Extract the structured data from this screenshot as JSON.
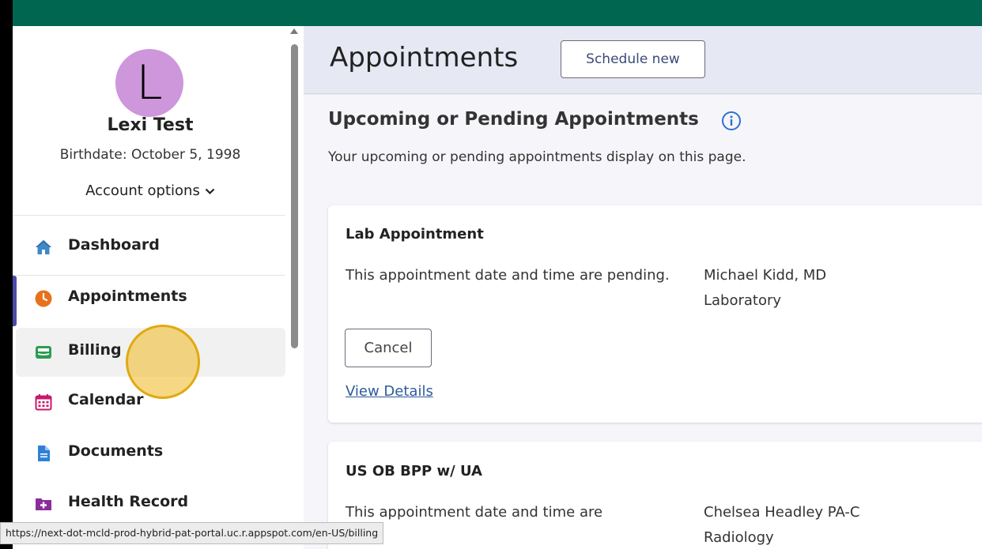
{
  "colors": {
    "topbar": "#00664f",
    "accent": "#4b4aa8",
    "link": "#2f5b9a",
    "avatar_bg": "#ce96db"
  },
  "user": {
    "initial": "L",
    "name": "Lexi Test",
    "birthdate": "Birthdate: October 5, 1998",
    "account_options": "Account options"
  },
  "sidebar": {
    "items": [
      {
        "label": "Dashboard",
        "icon": "home-icon"
      },
      {
        "label": "Appointments",
        "icon": "clock-icon"
      },
      {
        "label": "Billing",
        "icon": "billing-card-icon"
      },
      {
        "label": "Calendar",
        "icon": "calendar-icon"
      },
      {
        "label": "Documents",
        "icon": "document-icon"
      },
      {
        "label": "Health Record",
        "icon": "health-record-plus-icon"
      }
    ]
  },
  "header": {
    "title": "Appointments",
    "schedule_button": "Schedule new"
  },
  "section": {
    "title": "Upcoming or Pending Appointments",
    "description": "Your upcoming or pending appointments display on this page."
  },
  "appointments": [
    {
      "title": "Lab Appointment",
      "status": "This appointment date and time are pending.",
      "provider": "Michael Kidd, MD",
      "department": "Laboratory",
      "cancel_label": "Cancel",
      "details_label": "View Details"
    },
    {
      "title": "US OB BPP w/ UA",
      "status": "This appointment date and time are",
      "provider": "Chelsea Headley PA-C",
      "department": "Radiology"
    }
  ],
  "status_bar": {
    "url": "https://next-dot-mcld-prod-hybrid-pat-portal.uc.r.appspot.com/en-US/billing"
  }
}
